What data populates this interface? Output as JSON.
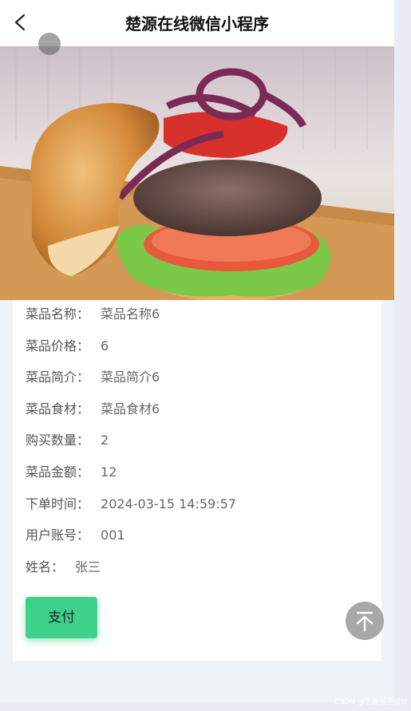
{
  "header": {
    "title": "楚源在线微信小程序"
  },
  "details": [
    {
      "label": "菜品名称：",
      "value": "菜品名称6"
    },
    {
      "label": "菜品价格：",
      "value": "6"
    },
    {
      "label": "菜品简介：",
      "value": "菜品简介6"
    },
    {
      "label": "菜品食材：",
      "value": "菜品食材6"
    },
    {
      "label": "购买数量：",
      "value": "2"
    },
    {
      "label": "菜品金额：",
      "value": "12"
    },
    {
      "label": "下单时间：",
      "value": "2024-03-15 14:59:57"
    },
    {
      "label": "用户账号：",
      "value": "001"
    },
    {
      "label": "姓名：",
      "value": "张三"
    }
  ],
  "actions": {
    "pay_label": "支付"
  },
  "watermark": "CSDN @艺馨程序设计",
  "icons": [
    "back-arrow-icon",
    "back-to-top-icon"
  ],
  "colors": {
    "pay_button": "#3ed18c",
    "background": "#eef3f8",
    "to_top": "#a8a8a8"
  }
}
